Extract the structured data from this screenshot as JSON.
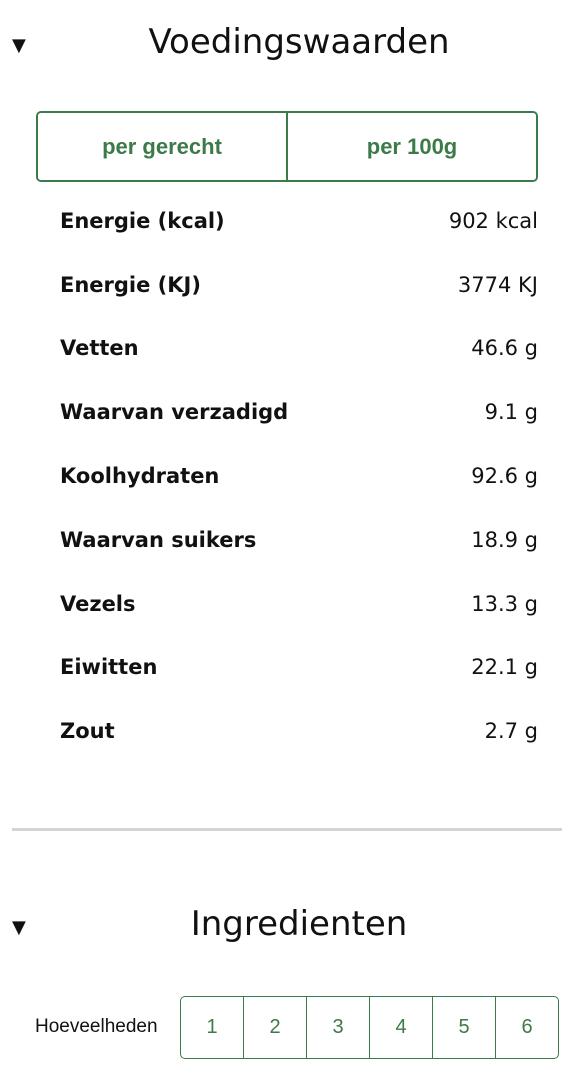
{
  "nutrition": {
    "title": "Voedingswaarden",
    "toggle_icon": "▼",
    "tabs": [
      {
        "label": "per gerecht"
      },
      {
        "label": "per 100g"
      }
    ],
    "rows": [
      {
        "name": "Energie (kcal)",
        "value": "902 kcal"
      },
      {
        "name": "Energie (KJ)",
        "value": "3774 KJ"
      },
      {
        "name": "Vetten",
        "value": "46.6 g"
      },
      {
        "name": "Waarvan verzadigd",
        "value": "9.1 g"
      },
      {
        "name": "Koolhydraten",
        "value": "92.6 g"
      },
      {
        "name": "Waarvan suikers",
        "value": "18.9 g"
      },
      {
        "name": "Vezels",
        "value": "13.3 g"
      },
      {
        "name": "Eiwitten",
        "value": "22.1 g"
      },
      {
        "name": "Zout",
        "value": "2.7 g"
      }
    ]
  },
  "ingredients": {
    "title": "Ingredienten",
    "toggle_icon": "▼",
    "amounts_label": "Hoeveelheden",
    "amount_options": [
      "1",
      "2",
      "3",
      "4",
      "5",
      "6"
    ]
  },
  "colors": {
    "accent": "#3d7a4a",
    "divider": "#d4d4d4"
  }
}
